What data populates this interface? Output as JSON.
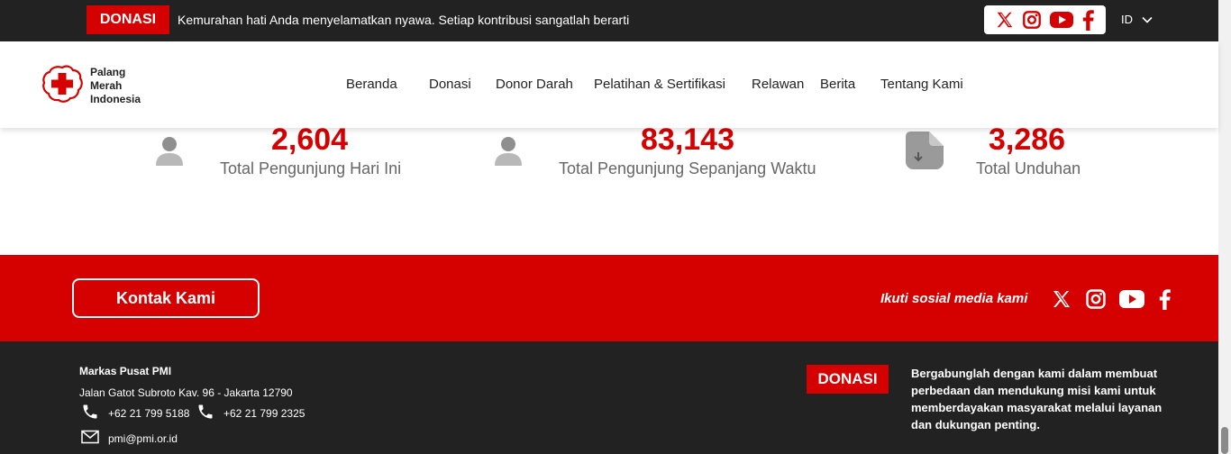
{
  "topbar": {
    "donate_label": "DONASI",
    "tagline": "Kemurahan hati Anda menyelamatkan nyawa. Setiap kontribusi sangatlah berarti",
    "language": "ID"
  },
  "logo": {
    "line1": "Palang",
    "line2": "Merah",
    "line3": "Indonesia"
  },
  "nav": {
    "items": [
      "Beranda",
      "Donasi",
      "Donor Darah",
      "Pelatihan & Sertifikasi",
      "Relawan",
      "Berita",
      "Tentang Kami"
    ]
  },
  "stats": [
    {
      "value": "2,604",
      "label": "Total Pengunjung Hari Ini",
      "icon": "user-icon"
    },
    {
      "value": "83,143",
      "label": "Total Pengunjung Sepanjang Waktu",
      "icon": "user-icon"
    },
    {
      "value": "3,286",
      "label": "Total Unduhan",
      "icon": "download-file-icon"
    }
  ],
  "contact_band": {
    "contact_label": "Kontak Kami",
    "follow_label": "Ikuti sosial media kami"
  },
  "footer": {
    "hq_title": "Markas Pusat PMI",
    "address": "Jalan Gatot Subroto Kav. 96 - Jakarta 12790",
    "phone1": "+62 21 799 5188",
    "phone2": "+62 21 799 2325",
    "email": "pmi@pmi.or.id",
    "donate_label": "DONASI",
    "mission": "Bergabunglah dengan kami dalam membuat perbedaan dan mendukung misi kami untuk memberdayakan masyarakat melalui layanan dan dukungan penting."
  },
  "colors": {
    "brand_red": "#d50000",
    "dark": "#222222",
    "white": "#ffffff"
  }
}
